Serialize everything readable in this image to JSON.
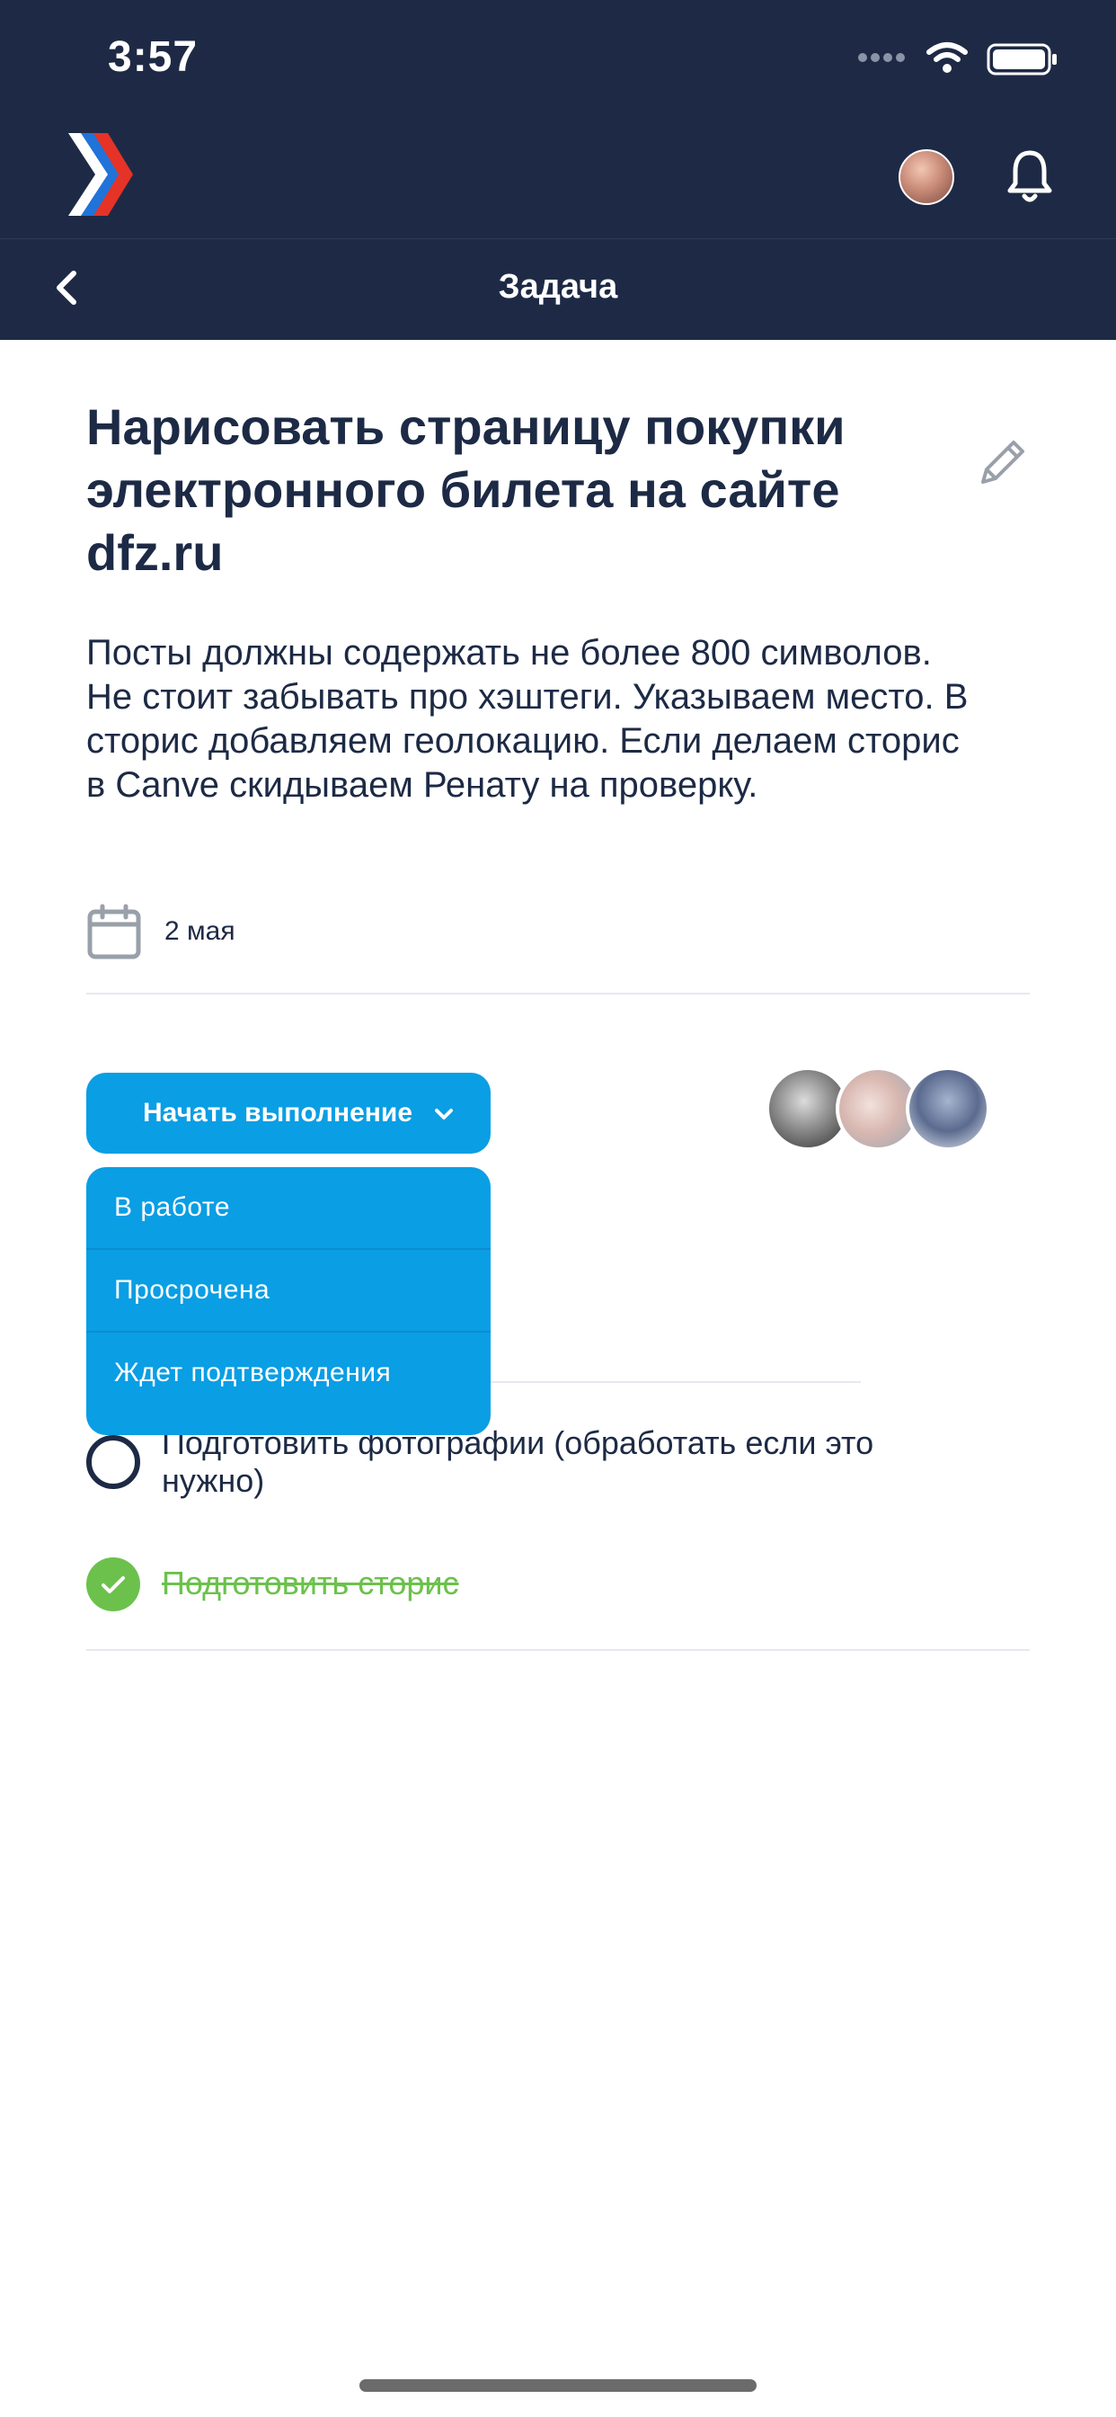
{
  "status_bar": {
    "time": "3:57"
  },
  "header": {
    "title": "Задача"
  },
  "task": {
    "title": "Нарисовать страницу покупки электронного билета на сайте dfz.ru",
    "description": "Посты должны содержать не более 800 символов. Не стоит забывать про хэштеги. Указываем место. В сторис добавляем геолокацию. Если делаем сторис в Canve скидываем Ренату на проверку.",
    "date": "2 мая"
  },
  "status_select": {
    "button_label": "Начать выполнение",
    "options": [
      "В работе",
      "Просрочена",
      "Ждет подтверждения"
    ]
  },
  "checklist": [
    {
      "text": "Подготовить фотографии (обработать если это нужно)",
      "done": false
    },
    {
      "text": "Подготовить сторис",
      "done": true
    }
  ],
  "colors": {
    "navy": "#1e2a45",
    "accent": "#0a9ee4",
    "done": "#6cc14c"
  }
}
